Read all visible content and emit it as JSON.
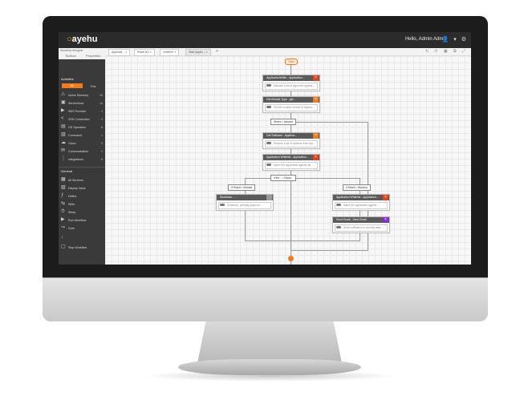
{
  "app": {
    "logo": "ayehu",
    "user": "Hello, Admin Admin",
    "top_icons": "👤 ▾ ⚙"
  },
  "tabs": [
    "Applicati... ×",
    "Reset AD ×",
    "Untitled*  ×",
    "Start Applic... ×",
    "+"
  ],
  "sidebar": {
    "search": "Workflow designer",
    "tab_left": "Toolbox",
    "tab_right": "Properties",
    "section1": "Activities",
    "orange_tab": "All",
    "other_tab": "Fav",
    "items": [
      {
        "icon": "⚠",
        "label": "Active Directory",
        "count": "15"
      },
      {
        "icon": "▣",
        "label": "ServiceNow",
        "count": "14"
      },
      {
        "icon": "▶",
        "label": "SMS Provider",
        "count": "4"
      },
      {
        "icon": "<",
        "label": "SSH Connection",
        "count": "3"
      },
      {
        "icon": "▤",
        "label": "OS Operation",
        "count": "8"
      },
      {
        "icon": "▥",
        "label": "Command",
        "count": "1"
      },
      {
        "icon": "☁",
        "label": "Cloud",
        "count": "3"
      },
      {
        "icon": "✉",
        "label": "Communication",
        "count": "2"
      },
      {
        "icon": "⋮",
        "label": "Integrations",
        "count": "8"
      }
    ],
    "section2": "General",
    "general": [
      {
        "icon": "▦",
        "label": "All Services"
      },
      {
        "icon": "▧",
        "label": "Display Value"
      },
      {
        "icon": "ƒ",
        "label": "Define"
      },
      {
        "icon": "⇆",
        "label": "Write"
      },
      {
        "icon": "⏱",
        "label": "Sleep"
      },
      {
        "icon": "▶",
        "label": "Run Workflow"
      },
      {
        "icon": "↪",
        "label": "Goto"
      },
      {
        "icon": "↓",
        "label": ""
      },
      {
        "icon": "▢",
        "label": "Stop Workflow"
      }
    ]
  },
  "workflow": {
    "start": "Start",
    "nodes": [
      {
        "title": "ApplicationWhite - Application...",
        "body": "Maintain a list of approved applica...",
        "badge": "×",
        "badge_color": "#e8421b"
      },
      {
        "title": "Get Module Type - get...",
        "body": "Get the module number of applica...",
        "badge": "×",
        "badge_color": "#f07c1e"
      },
      {
        "title": "Get Software - Applicat...",
        "body": "Retrieve a list of software from sys...",
        "badge": "×",
        "badge_color": "#f07c1e"
      },
      {
        "title": "Application Whitelist - Application...",
        "body": "Match the application against list...",
        "badge": "×",
        "badge_color": "#e8421b"
      },
      {
        "title": "Shutdown - ...",
        "body": "Shutdown, pending approval ...",
        "badge": "",
        "badge_color": "#999999"
      },
      {
        "title": "Application Whitelist - Application...",
        "body": "Match the application against ...",
        "badge": "×",
        "badge_color": "#e8421b"
      },
      {
        "title": "Send Email - Send Email",
        "body": "Send notification to security team ...",
        "badge": "×",
        "badge_color": "#8a2be2"
      }
    ],
    "conditions": [
      "Where = Allowed",
      "If the... = Equal...",
      "If Result = Allowed",
      "If Result = Blocked"
    ]
  }
}
